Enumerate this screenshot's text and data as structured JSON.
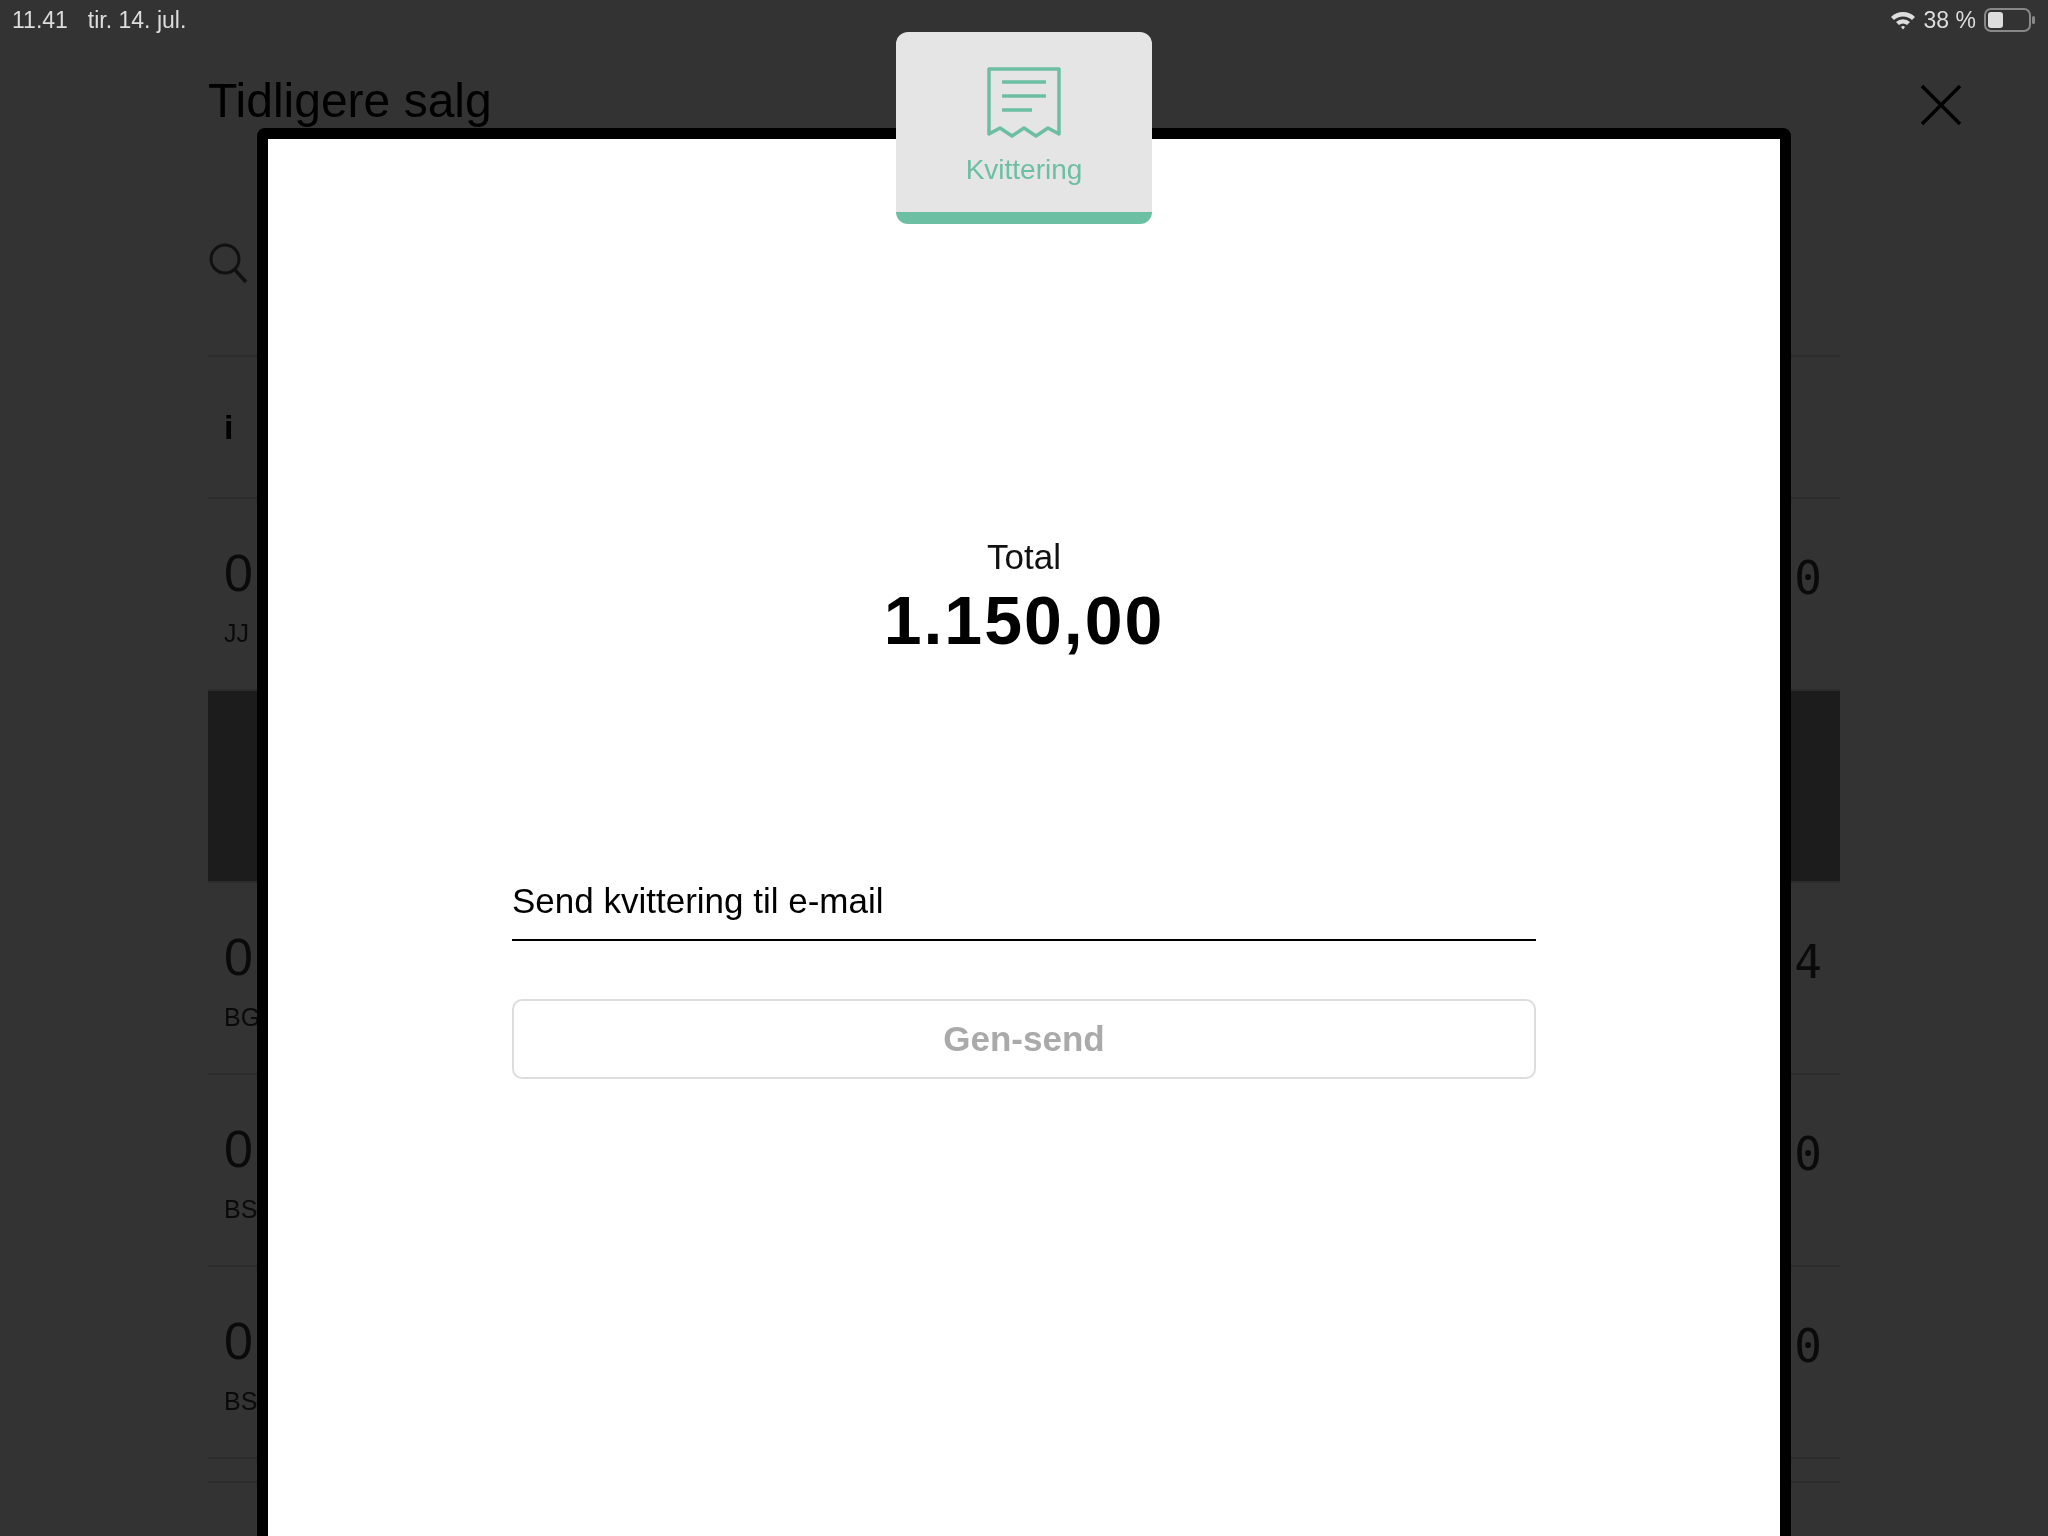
{
  "status_bar": {
    "time": "11.41",
    "date": "tir. 14. jul.",
    "battery": "38 %"
  },
  "background": {
    "title": "Tidligere salg",
    "column_header": "i",
    "rows": [
      {
        "title": "0",
        "subtitle": "JJ",
        "amount": "0",
        "selected": false
      },
      {
        "selected": true
      },
      {
        "title": "0",
        "subtitle": "BG",
        "amount": "4",
        "selected": false
      },
      {
        "title": "0",
        "subtitle": "BS",
        "amount": "0",
        "selected": false
      },
      {
        "title": "0",
        "subtitle": "BS",
        "amount": "0",
        "selected": false
      }
    ]
  },
  "modal": {
    "tabs": [
      {
        "label": "Kvittering",
        "selected": true
      }
    ],
    "total_label": "Total",
    "total_value": "1.150,00",
    "email_field": {
      "placeholder": "Send kvittering til e-mail"
    },
    "resend_button": {
      "label": "Gen-send",
      "disabled": true
    }
  }
}
